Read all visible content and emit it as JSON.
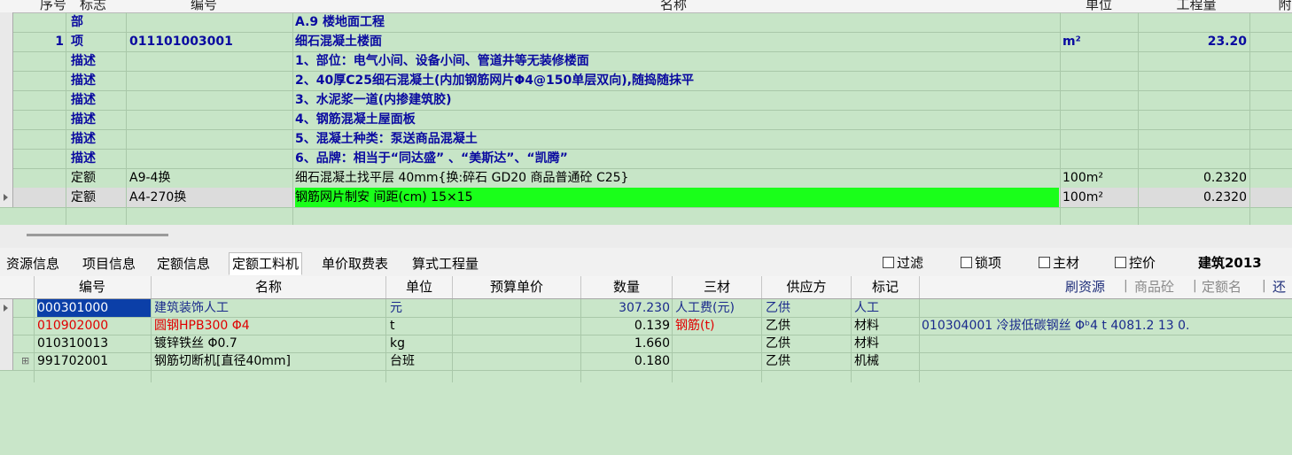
{
  "upper": {
    "columns": [
      "序号",
      "标志",
      "编号",
      "名称",
      "单位",
      "工程量",
      "附"
    ],
    "rows": [
      {
        "seq": "",
        "flag": "部",
        "code": "",
        "name": "A.9 楼地面工程",
        "unit": "",
        "qty": "",
        "style": "section"
      },
      {
        "seq": "1",
        "flag": "项",
        "code": "011101003001",
        "name": "细石混凝土楼面",
        "unit": "m²",
        "qty": "23.20",
        "style": "item"
      },
      {
        "seq": "",
        "flag": "描述",
        "code": "",
        "name": "1、部位：电气小间、设备小间、管道井等无装修楼面",
        "unit": "",
        "qty": "",
        "style": "desc"
      },
      {
        "seq": "",
        "flag": "描述",
        "code": "",
        "name": "2、40厚C25细石混凝土(内加钢筋网片Φ4@150单层双向),随捣随抹平",
        "unit": "",
        "qty": "",
        "style": "desc"
      },
      {
        "seq": "",
        "flag": "描述",
        "code": "",
        "name": "3、水泥浆一道(内掺建筑胶)",
        "unit": "",
        "qty": "",
        "style": "desc"
      },
      {
        "seq": "",
        "flag": "描述",
        "code": "",
        "name": "4、钢筋混凝土屋面板",
        "unit": "",
        "qty": "",
        "style": "desc"
      },
      {
        "seq": "",
        "flag": "描述",
        "code": "",
        "name": "5、混凝土种类：泵送商品混凝土",
        "unit": "",
        "qty": "",
        "style": "desc"
      },
      {
        "seq": "",
        "flag": "描述",
        "code": "",
        "name": "6、品牌：相当于“同达盛” 、“美斯达”、“凯腾”",
        "unit": "",
        "qty": "",
        "style": "desc"
      },
      {
        "seq": "",
        "flag": "定额",
        "code": "A9-4换",
        "name": "细石混凝土找平层 40mm{换:碎石 GD20  商品普通砼  C25}",
        "unit": "100m²",
        "qty": "0.2320",
        "style": "quota"
      },
      {
        "seq": "",
        "flag": "定额",
        "code": "A4-270换",
        "name": "钢筋网片制安 间距(cm) 15×15",
        "unit": "100m²",
        "qty": "0.2320",
        "style": "quota-current"
      }
    ]
  },
  "tabs": [
    "资源信息",
    "项目信息",
    "定额信息",
    "定额工料机",
    "单价取费表",
    "算式工程量"
  ],
  "active_tab": "定额工料机",
  "checkboxes": [
    "过滤",
    "锁项",
    "主材",
    "控价"
  ],
  "profile": "建筑2013",
  "lower": {
    "columns": [
      "编号",
      "名称",
      "单位",
      "预算单价",
      "数量",
      "三材",
      "供应方",
      "标记"
    ],
    "links": [
      "刷资源",
      "商品砼",
      "定额名",
      "还"
    ],
    "rows": [
      {
        "code": "000301000",
        "name": "建筑装饰人工",
        "unit": "元",
        "price": "",
        "qty": "307.230",
        "material": "人工费(元)",
        "supplier": "乙供",
        "mark": "人工",
        "extra": "",
        "style": "selected"
      },
      {
        "code": "010902000",
        "name": "圆钢HPB300 Φ4",
        "unit": "t",
        "price": "",
        "qty": "0.139",
        "material": "钢筋(t)",
        "supplier": "乙供",
        "mark": "材料",
        "extra": "010304001  冷拔低碳钢丝 Φᵇ4  t  4081.2    13  0.",
        "style": "red"
      },
      {
        "code": "010310013",
        "name": "镀锌铁丝 Φ0.7",
        "unit": "kg",
        "price": "",
        "qty": "1.660",
        "material": "",
        "supplier": "乙供",
        "mark": "材料",
        "extra": "",
        "style": "normal"
      },
      {
        "code": "991702001",
        "name": "钢筋切断机[直径40mm]",
        "unit": "台班",
        "price": "",
        "qty": "0.180",
        "material": "",
        "supplier": "乙供",
        "mark": "机械",
        "extra": "",
        "style": "normal"
      }
    ]
  }
}
